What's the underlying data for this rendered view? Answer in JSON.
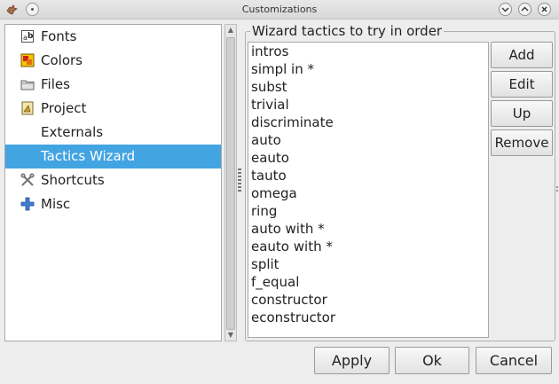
{
  "window": {
    "title": "Customizations"
  },
  "sidebar": {
    "items": [
      {
        "label": "Fonts",
        "icon": "fonts-icon"
      },
      {
        "label": "Colors",
        "icon": "colors-icon"
      },
      {
        "label": "Files",
        "icon": "folder-icon"
      },
      {
        "label": "Project",
        "icon": "project-icon"
      },
      {
        "label": "Externals",
        "icon": ""
      },
      {
        "label": "Tactics Wizard",
        "icon": "",
        "selected": true
      },
      {
        "label": "Shortcuts",
        "icon": "shortcuts-icon"
      },
      {
        "label": "Misc",
        "icon": "plus-icon"
      }
    ]
  },
  "panel": {
    "group_title": "Wizard tactics to try in order",
    "tactics": [
      "intros",
      "simpl in *",
      "subst",
      "trivial",
      "discriminate",
      "auto",
      "eauto",
      "tauto",
      "omega",
      "ring",
      "auto with *",
      "eauto with *",
      "split",
      "f_equal",
      "constructor",
      "econstructor"
    ],
    "buttons": {
      "add": "Add",
      "edit": "Edit",
      "up": "Up",
      "remove": "Remove"
    }
  },
  "footer": {
    "apply": "Apply",
    "ok": "Ok",
    "cancel": "Cancel"
  },
  "colors": {
    "selection": "#43a4e2"
  }
}
